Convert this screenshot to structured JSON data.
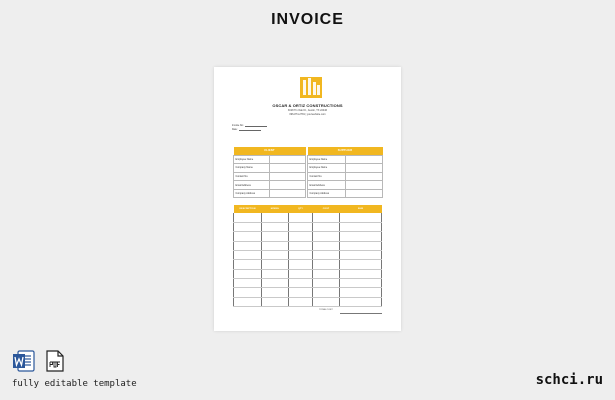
{
  "header": {
    "title": "INVOICE"
  },
  "company": {
    "name": "OSCAR & ORTIZ CONSTRUCTIONS",
    "address": "3028 Tin Oak Dr., Austin, TX 22446",
    "contact": "096-874-2781 | yourwebsite.com"
  },
  "invoice_meta": {
    "invoice_no_label": "Invoice No.:",
    "date_label": "Date:"
  },
  "party_table": {
    "client_header": "CLIENT",
    "supplier_header": "SUPPLIER",
    "client_rows": [
      "Employee Name",
      "Company Name",
      "Contact No.",
      "Email Address",
      "Company Address"
    ],
    "supplier_rows": [
      "Employee Name",
      "Employee Name",
      "Contact No.",
      "Email Address",
      "Company Address"
    ]
  },
  "items_table": {
    "columns": [
      "DESCRIPTION",
      "MODEL",
      "QTY",
      "COST",
      "SUM"
    ],
    "total_label": "TOTAL COST"
  },
  "footer": {
    "caption": "fully editable template",
    "brand": "schci.ru",
    "icons": [
      "word-icon",
      "pdf-icon"
    ]
  },
  "colors": {
    "accent": "#f1b720",
    "word": "#2b579a"
  }
}
